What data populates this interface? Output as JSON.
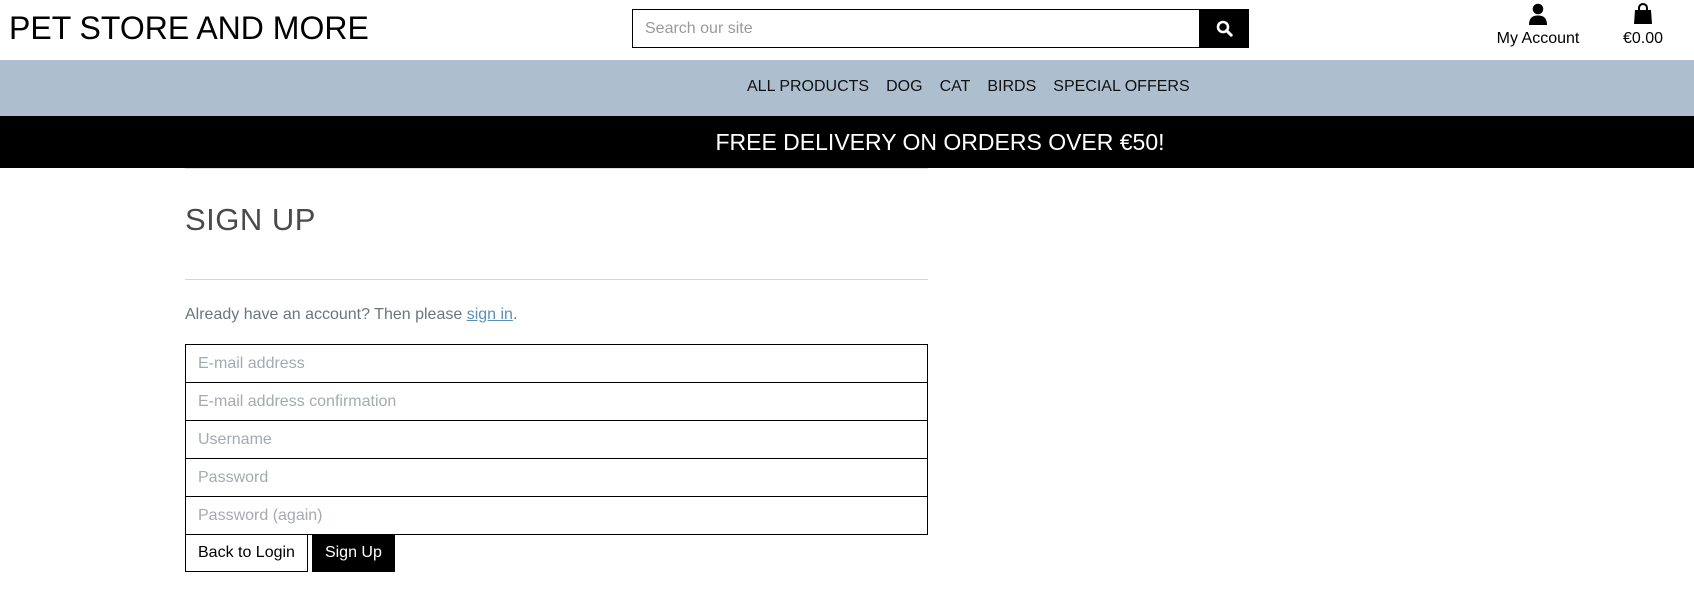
{
  "header": {
    "logo": "PET STORE AND MORE",
    "search_placeholder": "Search our site",
    "account_label": "My Account",
    "bag_total": "€0.00"
  },
  "nav": {
    "items": [
      "ALL PRODUCTS",
      "DOG",
      "CAT",
      "BIRDS",
      "SPECIAL OFFERS"
    ]
  },
  "banner": {
    "text": "FREE DELIVERY ON ORDERS OVER €50!"
  },
  "main": {
    "title": "SIGN UP",
    "intro_prefix": "Already have an account? Then please ",
    "intro_link": "sign in",
    "intro_suffix": ".",
    "fields": {
      "email": "E-mail address",
      "email_confirm": "E-mail address confirmation",
      "username": "Username",
      "password": "Password",
      "password_again": "Password (again)"
    },
    "buttons": {
      "back": "Back to Login",
      "signup": "Sign Up"
    }
  },
  "colors": {
    "nav_bg": "#adbfcf",
    "banner_bg": "#000000",
    "link": "#5b8fb6"
  },
  "icons": {
    "search": "search-icon",
    "account": "user-icon",
    "bag": "shopping-bag-icon"
  }
}
